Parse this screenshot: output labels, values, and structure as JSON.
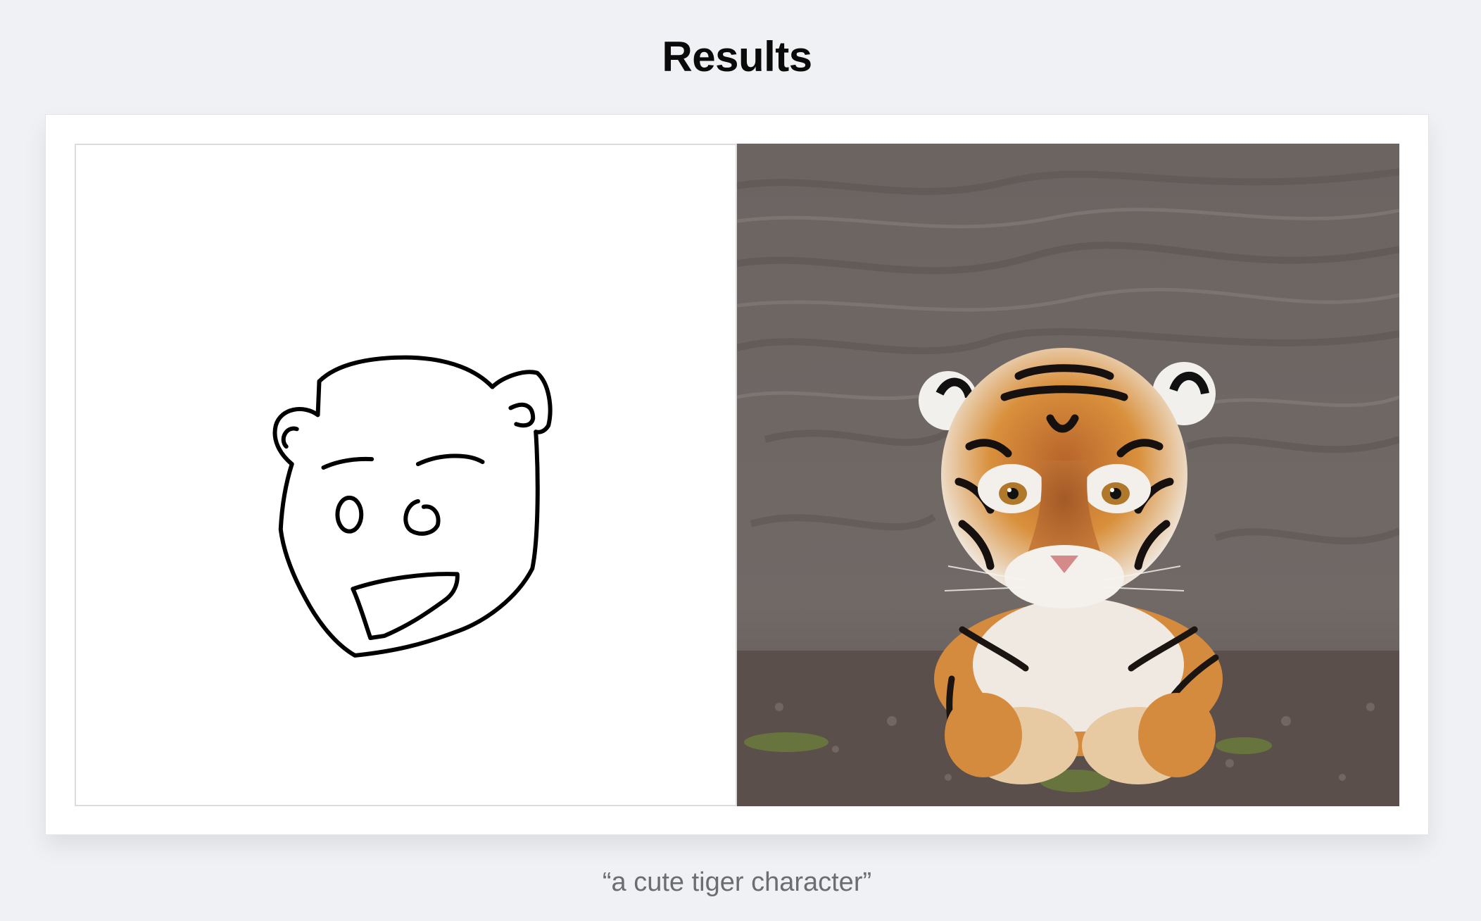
{
  "header": {
    "title": "Results"
  },
  "result": {
    "sketch_alt": "hand-drawn sketch",
    "generated_alt": "generated tiger image",
    "caption": "“a cute tiger character”"
  }
}
